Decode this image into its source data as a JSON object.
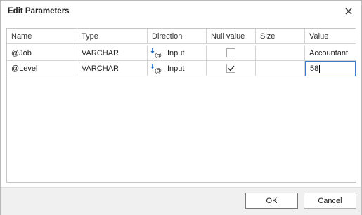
{
  "dialog": {
    "title": "Edit Parameters",
    "ok_label": "OK",
    "cancel_label": "Cancel"
  },
  "grid": {
    "columns": [
      "Name",
      "Type",
      "Direction",
      "Null value",
      "Size",
      "Value"
    ],
    "rows": [
      {
        "name": "@Job",
        "type": "VARCHAR",
        "direction": "Input",
        "null_value": false,
        "size": "",
        "value": "Accountant"
      },
      {
        "name": "@Level",
        "type": "VARCHAR",
        "direction": "Input",
        "null_value": true,
        "size": "",
        "value": "58"
      }
    ]
  },
  "icons": {
    "close": "close-icon",
    "direction": "input-direction-icon",
    "check": "checkmark-icon"
  },
  "colors": {
    "border": "#c6c6c6",
    "focus_border": "#3d7ac9",
    "icon_blue": "#1a66c9"
  }
}
